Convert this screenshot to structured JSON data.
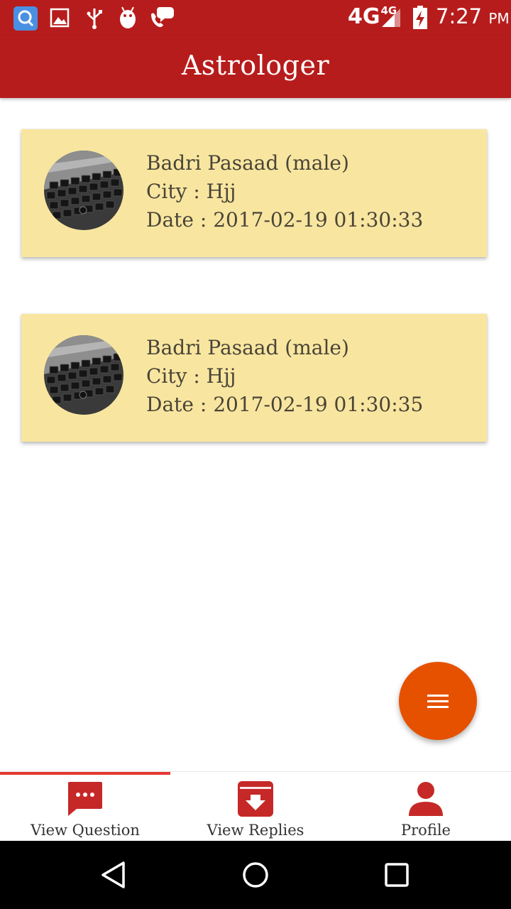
{
  "status_bar": {
    "network": "4G",
    "network_small": "4G",
    "time": "7:27",
    "ampm": "PM"
  },
  "app_bar": {
    "title": "Astrologer"
  },
  "cards": [
    {
      "name": "Badri Pasaad (male)",
      "city": "City : Hjj",
      "date": "Date : 2017-02-19 01:30:33"
    },
    {
      "name": "Badri Pasaad (male)",
      "city": "City : Hjj",
      "date": "Date : 2017-02-19 01:30:35"
    }
  ],
  "bottom_nav": {
    "items": [
      {
        "label": "View Question",
        "icon": "chat-dots-icon",
        "active": true
      },
      {
        "label": "View Replies",
        "icon": "archive-download-icon",
        "active": false
      },
      {
        "label": "Profile",
        "icon": "person-icon",
        "active": false
      }
    ]
  },
  "colors": {
    "primary": "#b71c1c",
    "card": "#f8e6a0",
    "fab": "#e65100",
    "nav_icon": "#c62828",
    "active_indicator": "#e53935"
  }
}
